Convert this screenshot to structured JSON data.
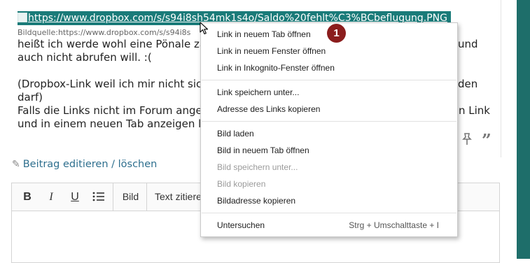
{
  "post": {
    "image_link_text": "https://www.dropbox.com/s/s94i8sh54mk1s4o/Saldo%20fehlt%C3%BCbeflugung.PNG",
    "caption": "Bildquelle:https://www.dropbox.com/s/s94i8s",
    "lines": [
      "heißt ich werde wohl eine Pönale zah",
      "auch nicht abrufen will. :(",
      "(Dropbox-Link weil ich mir nicht sich",
      "darf)",
      "Falls die Links nicht im Forum angeze",
      "und in einem neuen Tab anzeigen las"
    ],
    "right_fragments": [
      "und",
      "den",
      "n Link"
    ],
    "edit_link": "Beitrag editieren / löschen"
  },
  "editor": {
    "toolbar": {
      "bold": "B",
      "italic": "I",
      "underline": "U",
      "image": "Bild",
      "quote": "Text zitiere"
    }
  },
  "context_menu": {
    "items": [
      {
        "label": "Link in neuem Tab öffnen",
        "disabled": false
      },
      {
        "label": "Link in neuem Fenster öffnen",
        "disabled": false
      },
      {
        "label": "Link in Inkognito-Fenster öffnen",
        "disabled": false
      },
      {
        "label": "Link speichern unter...",
        "disabled": false
      },
      {
        "label": "Adresse des Links kopieren",
        "disabled": false
      },
      {
        "label": "Bild laden",
        "disabled": false
      },
      {
        "label": "Bild in neuem Tab öffnen",
        "disabled": false
      },
      {
        "label": "Bild speichern unter...",
        "disabled": true
      },
      {
        "label": "Bild kopieren",
        "disabled": true
      },
      {
        "label": "Bildadresse kopieren",
        "disabled": false
      },
      {
        "label": "Untersuchen",
        "shortcut": "Strg + Umschalttaste + I",
        "disabled": false
      }
    ]
  },
  "annotation": {
    "badge_number": "1"
  },
  "colors": {
    "accent": "#1a7b79",
    "badge": "#8b1d1d",
    "link": "#2e6f8e"
  },
  "icons": [
    "image-broken-icon",
    "pin-icon",
    "quote-icon",
    "pencil-icon",
    "list-icon",
    "cursor-icon"
  ]
}
